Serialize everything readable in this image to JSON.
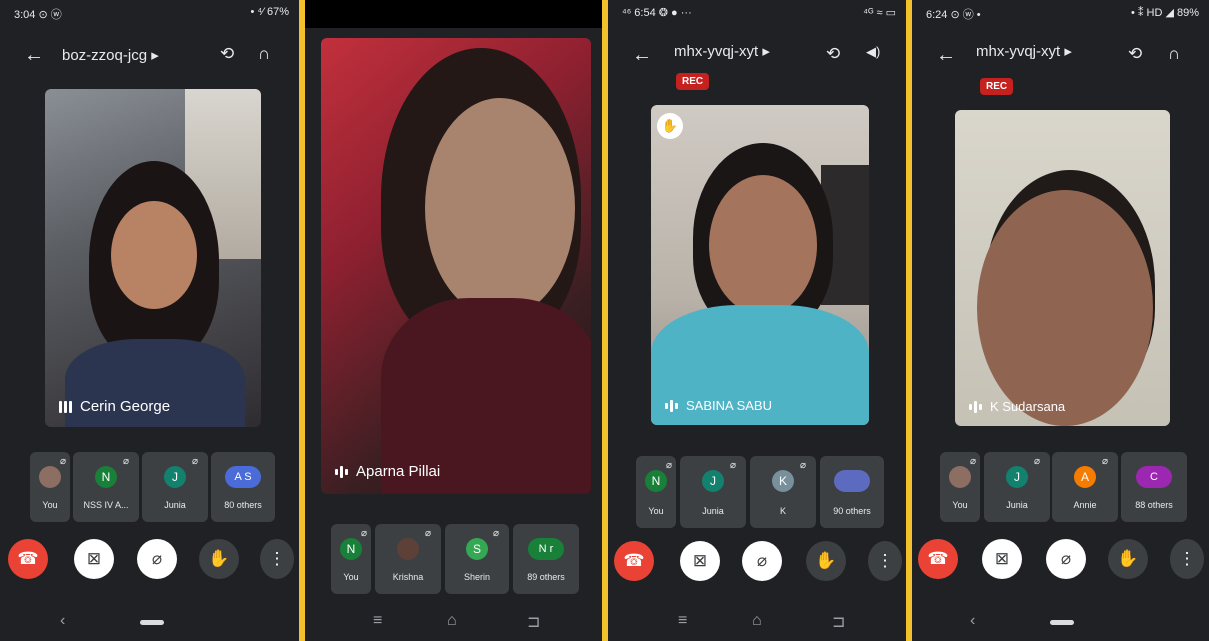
{
  "panels": [
    {
      "status_left": "3:04 ⊙ ⓦ",
      "status_right": "• ⁴⁄ 67%",
      "meeting_code": "boz-zzoq-jcg ▸",
      "speaker": "Cerin George",
      "tiles": [
        {
          "label": "You",
          "avatar": "",
          "color": "#8d6e63"
        },
        {
          "label": "NSS IV A...",
          "avatar": "N",
          "color": "#188038"
        },
        {
          "label": "Junia",
          "avatar": "J",
          "color": "#12826f"
        },
        {
          "label": "80 others",
          "avatar": "A S",
          "color": "#4a6bd8"
        }
      ]
    },
    {
      "speaker": "Aparna Pillai",
      "tiles": [
        {
          "label": "You",
          "avatar": "N",
          "color": "#188038"
        },
        {
          "label": "Krishna",
          "avatar": "",
          "color": "#5d4037"
        },
        {
          "label": "Sherin",
          "avatar": "S",
          "color": "#34a853"
        },
        {
          "label": "89 others",
          "avatar": "N r",
          "color": "#188038"
        }
      ]
    },
    {
      "status_left": "⁴⁶ 6:54 ❂ ● ···",
      "status_right": "⁴ᴳ ≈ ▭",
      "meeting_code": "mhx-yvqj-xyt ▸",
      "rec": "REC",
      "speaker": "SABINA SABU",
      "tiles": [
        {
          "label": "You",
          "avatar": "N",
          "color": "#188038"
        },
        {
          "label": "Junia",
          "avatar": "J",
          "color": "#12826f"
        },
        {
          "label": "K",
          "avatar": "K",
          "color": "#78909c"
        },
        {
          "label": "90 others",
          "avatar": "",
          "color": "#5c6bc0"
        }
      ]
    },
    {
      "status_left": "6:24 ⊙ ⓦ •",
      "status_right": "• ⁑ HD ◢ 89%",
      "meeting_code": "mhx-yvqj-xyt ▸",
      "rec": "REC",
      "speaker": "K Sudarsana",
      "tiles": [
        {
          "label": "You",
          "avatar": "",
          "color": "#8d6e63"
        },
        {
          "label": "Junia",
          "avatar": "J",
          "color": "#12826f"
        },
        {
          "label": "Annie",
          "avatar": "A",
          "color": "#f57c00"
        },
        {
          "label": "88 others",
          "avatar": "C",
          "color": "#9c27b0"
        }
      ]
    }
  ],
  "icons": {
    "back": "←",
    "switch_camera": "⟲",
    "audio": "∩",
    "speaker_phone": "◀)",
    "end_call": "☎",
    "camera_off": "⊠",
    "mic_off": "⌀",
    "raise_hand": "✋",
    "more": "⋮",
    "muted": "⌀"
  },
  "colors": {
    "background": "#202124",
    "tile": "#3c4043",
    "end_call": "#ea4335",
    "rec": "#c5221f",
    "divider": "#f3c12b"
  }
}
